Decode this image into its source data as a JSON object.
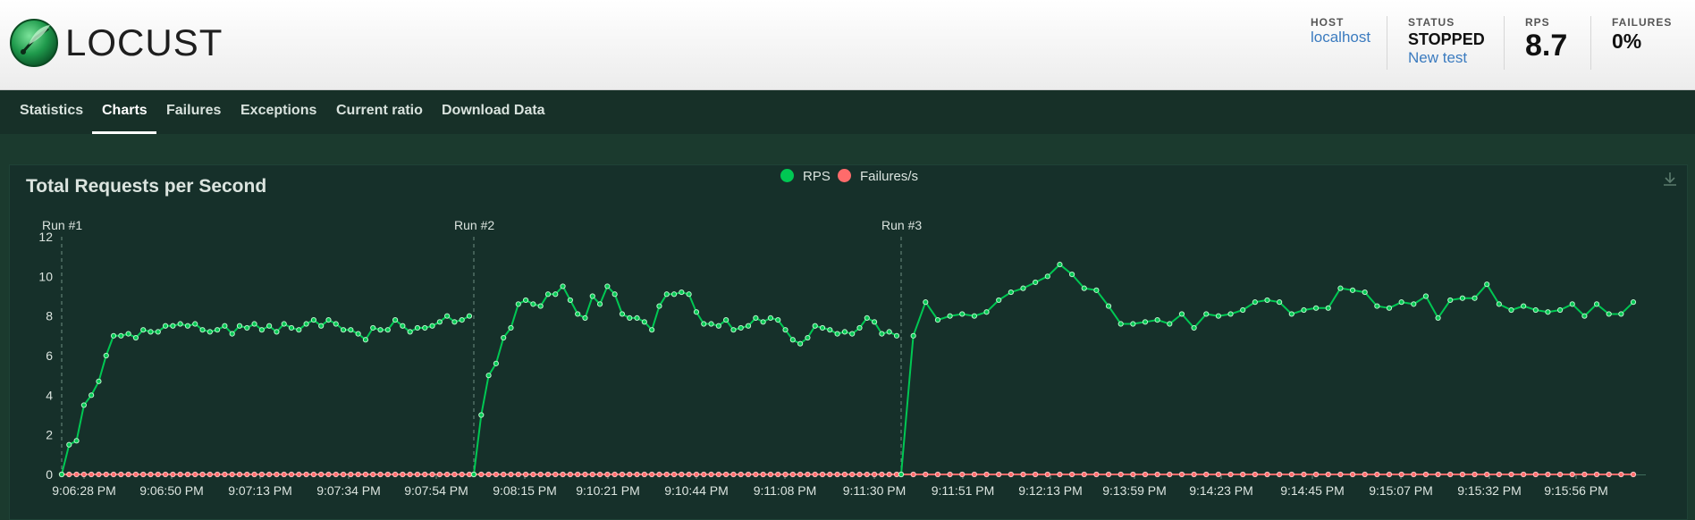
{
  "header": {
    "logo_text": "LOCUST",
    "host": {
      "label": "HOST",
      "value": "localhost"
    },
    "status": {
      "label": "STATUS",
      "value": "STOPPED",
      "action": "New test"
    },
    "rps": {
      "label": "RPS",
      "value": "8.7"
    },
    "failures": {
      "label": "FAILURES",
      "value": "0%"
    }
  },
  "tabs": [
    {
      "label": "Statistics",
      "active": false
    },
    {
      "label": "Charts",
      "active": true
    },
    {
      "label": "Failures",
      "active": false
    },
    {
      "label": "Exceptions",
      "active": false
    },
    {
      "label": "Current ratio",
      "active": false
    },
    {
      "label": "Download Data",
      "active": false
    }
  ],
  "colors": {
    "rps": "#00c853",
    "failures": "#ff6b6b"
  },
  "icons": [
    "download-icon"
  ],
  "chart_data": {
    "type": "line",
    "title": "Total Requests per Second",
    "legend": [
      "RPS",
      "Failures/s"
    ],
    "legend_placement": "top-center",
    "ylim": [
      0,
      12
    ],
    "yticks": [
      0,
      2,
      4,
      6,
      8,
      10,
      12
    ],
    "xtick_labels": [
      "9:06:28 PM",
      "9:06:50 PM",
      "9:07:13 PM",
      "9:07:34 PM",
      "9:07:54 PM",
      "9:08:15 PM",
      "9:10:21 PM",
      "9:10:44 PM",
      "9:11:08 PM",
      "9:11:30 PM",
      "9:11:51 PM",
      "9:12:13 PM",
      "9:13:59 PM",
      "9:14:23 PM",
      "9:14:45 PM",
      "9:15:07 PM",
      "9:15:32 PM",
      "9:15:56 PM"
    ],
    "markers": [
      "Run #1",
      "Run #2",
      "Run #3"
    ],
    "runs": [
      {
        "marker": "Run #1",
        "rps": [
          0,
          1.5,
          1.7,
          3.5,
          4,
          4.7,
          6,
          7,
          7,
          7.1,
          6.9,
          7.3,
          7.2,
          7.2,
          7.5,
          7.5,
          7.6,
          7.5,
          7.6,
          7.3,
          7.2,
          7.3,
          7.5,
          7.1,
          7.5,
          7.4,
          7.6,
          7.3,
          7.5,
          7.2,
          7.6,
          7.4,
          7.3,
          7.6,
          7.8,
          7.5,
          7.8,
          7.6,
          7.3,
          7.3,
          7.1,
          6.8,
          7.4,
          7.3,
          7.3,
          7.8,
          7.5,
          7.2,
          7.4,
          7.4,
          7.5,
          7.7,
          8,
          7.7,
          7.8,
          8
        ],
        "failures": [
          0,
          0,
          0,
          0,
          0,
          0,
          0,
          0,
          0,
          0,
          0,
          0,
          0,
          0,
          0,
          0,
          0,
          0,
          0,
          0,
          0,
          0,
          0,
          0,
          0,
          0,
          0,
          0,
          0,
          0,
          0,
          0,
          0,
          0,
          0,
          0,
          0,
          0,
          0,
          0,
          0,
          0,
          0,
          0,
          0,
          0,
          0,
          0,
          0,
          0,
          0,
          0,
          0,
          0,
          0,
          0
        ]
      },
      {
        "marker": "Run #2",
        "rps": [
          0,
          3,
          5,
          5.6,
          6.9,
          7.4,
          8.6,
          8.8,
          8.6,
          8.5,
          9.1,
          9.1,
          9.5,
          8.8,
          8.1,
          7.9,
          9,
          8.6,
          9.5,
          9.1,
          8.1,
          7.9,
          7.9,
          7.7,
          7.3,
          8.5,
          9.1,
          9.1,
          9.2,
          9.1,
          8.2,
          7.6,
          7.6,
          7.5,
          7.8,
          7.3,
          7.4,
          7.5,
          7.9,
          7.7,
          7.9,
          7.8,
          7.3,
          6.8,
          6.6,
          6.9,
          7.5,
          7.4,
          7.3,
          7.1,
          7.2,
          7.1,
          7.4,
          7.9,
          7.7,
          7.1,
          7.2,
          7
        ],
        "failures": [
          0,
          0,
          0,
          0,
          0,
          0,
          0,
          0,
          0,
          0,
          0,
          0,
          0,
          0,
          0,
          0,
          0,
          0,
          0,
          0,
          0,
          0,
          0,
          0,
          0,
          0,
          0,
          0,
          0,
          0,
          0,
          0,
          0,
          0,
          0,
          0,
          0,
          0,
          0,
          0,
          0,
          0,
          0,
          0,
          0,
          0,
          0,
          0,
          0,
          0,
          0,
          0,
          0,
          0,
          0,
          0,
          0,
          0
        ]
      },
      {
        "marker": "Run #3",
        "rps": [
          0,
          7,
          8.7,
          7.8,
          8,
          8.1,
          8,
          8.2,
          8.8,
          9.2,
          9.4,
          9.7,
          10,
          10.6,
          10.1,
          9.4,
          9.3,
          8.5,
          7.6,
          7.6,
          7.7,
          7.8,
          7.6,
          8.1,
          7.4,
          8.1,
          8,
          8.1,
          8.3,
          8.7,
          8.8,
          8.7,
          8.1,
          8.3,
          8.4,
          8.4,
          9.4,
          9.3,
          9.2,
          8.5,
          8.4,
          8.7,
          8.6,
          9,
          7.9,
          8.8,
          8.9,
          8.9,
          9.6,
          8.6,
          8.3,
          8.5,
          8.3,
          8.2,
          8.3,
          8.6,
          8,
          8.6,
          8.1,
          8.1,
          8.7
        ],
        "failures": [
          0,
          0,
          0,
          0,
          0,
          0,
          0,
          0,
          0,
          0,
          0,
          0,
          0,
          0,
          0,
          0,
          0,
          0,
          0,
          0,
          0,
          0,
          0,
          0,
          0,
          0,
          0,
          0,
          0,
          0,
          0,
          0,
          0,
          0,
          0,
          0,
          0,
          0,
          0,
          0,
          0,
          0,
          0,
          0,
          0,
          0,
          0,
          0,
          0,
          0,
          0,
          0,
          0,
          0,
          0,
          0,
          0,
          0,
          0,
          0,
          0
        ]
      }
    ]
  }
}
